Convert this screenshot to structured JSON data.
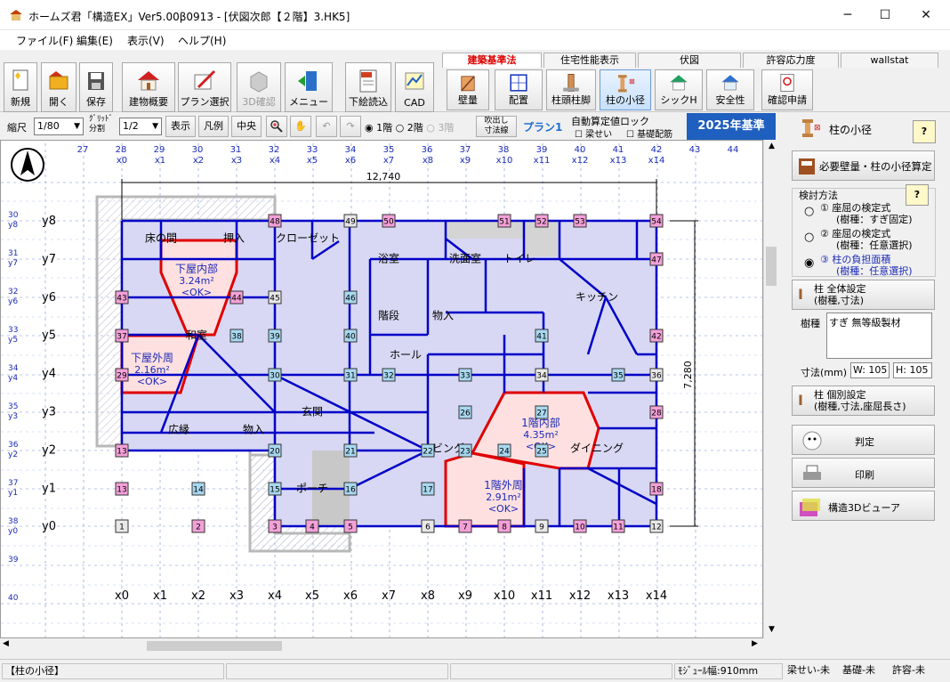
{
  "title": "ホームズ君「構造EX」Ver5.00β0913 - [伏図次郎【２階】3.HK5]",
  "window_controls": {
    "minimize": "─",
    "maximize": "☐",
    "close": "✕"
  },
  "menu": [
    "ファイル(F)",
    "編集(E)",
    "表示(V)",
    "ヘルプ(H)"
  ],
  "toolbar_left": [
    {
      "label": "新規",
      "icon": "new-file-icon"
    },
    {
      "label": "開く",
      "icon": "open-folder-icon"
    },
    {
      "label": "保存",
      "icon": "save-icon"
    },
    {
      "label": "建物概要",
      "icon": "house-icon"
    },
    {
      "label": "プラン選択",
      "icon": "plan-select-icon"
    },
    {
      "label": "3D確認",
      "icon": "3d-icon",
      "disabled": true
    },
    {
      "label": "メニュー",
      "icon": "menu-exit-icon"
    },
    {
      "label": "下絵読込",
      "icon": "jpg-import-icon"
    },
    {
      "label": "CAD",
      "icon": "cad-icon"
    }
  ],
  "tabs": [
    "建築基準法",
    "住宅性能表示",
    "伏図",
    "許容応力度",
    "wallstat"
  ],
  "active_tab": "建築基準法",
  "toolbar_right": [
    {
      "label": "壁量",
      "icon": "wall-amount-icon"
    },
    {
      "label": "配置",
      "icon": "layout-icon"
    },
    {
      "label": "柱頭柱脚",
      "icon": "column-joint-icon"
    },
    {
      "label": "柱の小径",
      "icon": "column-diameter-icon",
      "selected": true
    },
    {
      "label": "シックH",
      "icon": "sick-house-icon"
    },
    {
      "label": "安全性",
      "icon": "safety-icon"
    },
    {
      "label": "確認申請",
      "icon": "application-icon"
    }
  ],
  "toolbar2": {
    "scale_label": "縮尺",
    "scale_value": "1/80",
    "grid_label_1": "ｸﾞﾘｯﾄﾞ",
    "grid_label_2": "分割",
    "grid_value": "1/2",
    "display_button": "表示",
    "legend_button": "凡例",
    "center_button": "中央",
    "floor1": "1階",
    "floor2": "2階",
    "floor3": "3階",
    "fukidashi_1": "吹出し",
    "fukidashi_2": "寸法線",
    "plan": "プラン1",
    "auto_lock": "自動算定値ロック",
    "beam": "梁せい",
    "foundation": "基礎配筋",
    "standard_badge": "2025年基準"
  },
  "canvas": {
    "top_grid_nums": [
      "27",
      "28",
      "29",
      "30",
      "31",
      "32",
      "33",
      "34",
      "35",
      "36",
      "37",
      "38",
      "39",
      "40",
      "41",
      "42",
      "43",
      "44"
    ],
    "x_labels": [
      "x0",
      "x1",
      "x2",
      "x3",
      "x4",
      "x5",
      "x6",
      "x7",
      "x8",
      "x9",
      "x10",
      "x11",
      "x12",
      "x13",
      "x14"
    ],
    "y_labels": [
      "y8",
      "y7",
      "y6",
      "y5",
      "y4",
      "y3",
      "y2",
      "y1",
      "y0"
    ],
    "left_nums": [
      "30",
      "31",
      "32",
      "33",
      "34",
      "35",
      "36",
      "37",
      "38",
      "39",
      "40"
    ],
    "overall_width": "12,740",
    "overall_height": "7,280",
    "compass": "N",
    "rooms": [
      "床の間",
      "押入",
      "クローゼット",
      "浴室",
      "洗面室",
      "トイレ",
      "和室",
      "階段",
      "物入",
      "キッチン",
      "ホール",
      "玄関",
      "広縁",
      "物入",
      "リビング",
      "ダイニング",
      "ポーチ"
    ],
    "zones": [
      {
        "name": "下屋内部",
        "area": "3.24m²",
        "result": "<OK>"
      },
      {
        "name": "下屋外周",
        "area": "2.16m²",
        "result": "<OK>"
      },
      {
        "name": "1階内部",
        "area": "4.35m²",
        "result": "<OK>"
      },
      {
        "name": "1階外周",
        "area": "2.91m²",
        "result": "<OK>"
      }
    ],
    "column_numbers": [
      "1",
      "2",
      "3",
      "4",
      "5",
      "6",
      "7",
      "8",
      "9",
      "10",
      "11",
      "12",
      "13",
      "14",
      "15",
      "16",
      "17",
      "18",
      "13",
      "20",
      "21",
      "22",
      "23",
      "24",
      "25",
      "26",
      "27",
      "28",
      "29",
      "30",
      "31",
      "32",
      "33",
      "34",
      "35",
      "36",
      "37",
      "38",
      "39",
      "40",
      "41",
      "42",
      "43",
      "44",
      "45",
      "46",
      "47",
      "48",
      "49",
      "50",
      "51",
      "52",
      "53",
      "54"
    ]
  },
  "right_panel": {
    "title": "柱の小径",
    "help": "?",
    "calc_button": "必要壁量・柱の小径算定",
    "method_label": "検討方法",
    "options": [
      {
        "line1": "① 座屈の検定式",
        "line2": "(樹種：すぎ固定)"
      },
      {
        "line1": "② 座屈の検定式",
        "line2": "(樹種：任意選択)"
      },
      {
        "line1": "③ 柱の負担面積",
        "line2": "(樹種：任意選択)"
      }
    ],
    "selected_option": 2,
    "column_setting_1": "柱 全体設定",
    "column_setting_2": "(樹種,寸法)",
    "species_label": "樹種",
    "species_value": "すぎ 無等級製材",
    "size_label": "寸法(mm)",
    "width_value": "W: 105",
    "height_value": "H: 105",
    "individual_1": "柱 個別設定",
    "individual_2": "(樹種,寸法,座屈長さ)",
    "judge": "判定",
    "print": "印刷",
    "viewer": "構造3Dビューア"
  },
  "status": {
    "mode": "【柱の小径】",
    "module": "ﾓｼﾞｭｰﾙ幅:910mm",
    "beam": "梁せい-未",
    "foundation": "基礎-未",
    "allowable": "許容-未"
  },
  "colors": {
    "wall": "#0000cc",
    "fill": "#d8d8f8",
    "red": "#e00000",
    "tab_active": "#e00000",
    "badge": "#1f5fbf"
  }
}
